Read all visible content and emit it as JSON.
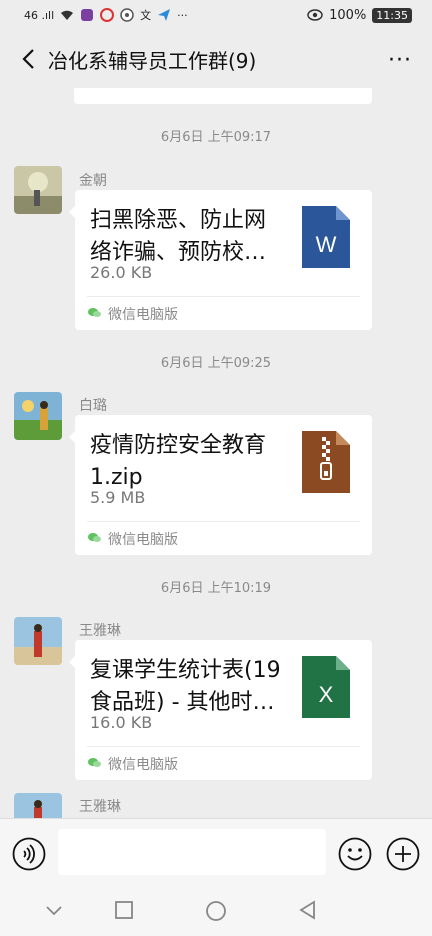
{
  "status_bar": {
    "signal": "46 .ıll",
    "left_icons": [
      "wifi-icon",
      "notification-icon",
      "app-icon",
      "app-icon",
      "text-icon",
      "send-icon"
    ],
    "more": "···",
    "battery": "100%",
    "time": "11:35"
  },
  "nav": {
    "title": "冶化系辅导员工作群(9)",
    "more": "···"
  },
  "messages": [
    {
      "time": "6月6日 上午09:17",
      "sender": "金朝",
      "file_name": "扫黑除恶、防止网络诈骗、预防校…",
      "file_size": "26.0 KB",
      "source": "微信电脑版",
      "file_type": "word",
      "file_badge": "W",
      "icon_color": "#2b579a"
    },
    {
      "time": "6月6日 上午09:25",
      "sender": "白璐",
      "file_name": "疫情防控安全教育1.zip",
      "file_size": "5.9 MB",
      "source": "微信电脑版",
      "file_type": "zip",
      "file_badge": "",
      "icon_color": "#8b4a22"
    },
    {
      "time": "6月6日 上午10:19",
      "sender": "王雅琳",
      "file_name": "复课学生统计表(19食品班) - 其他时…",
      "file_size": "16.0 KB",
      "source": "微信电脑版",
      "file_type": "excel",
      "file_badge": "X",
      "icon_color": "#217346"
    }
  ],
  "partial_sender": "王雅琳",
  "input": {
    "value": "",
    "placeholder": ""
  }
}
